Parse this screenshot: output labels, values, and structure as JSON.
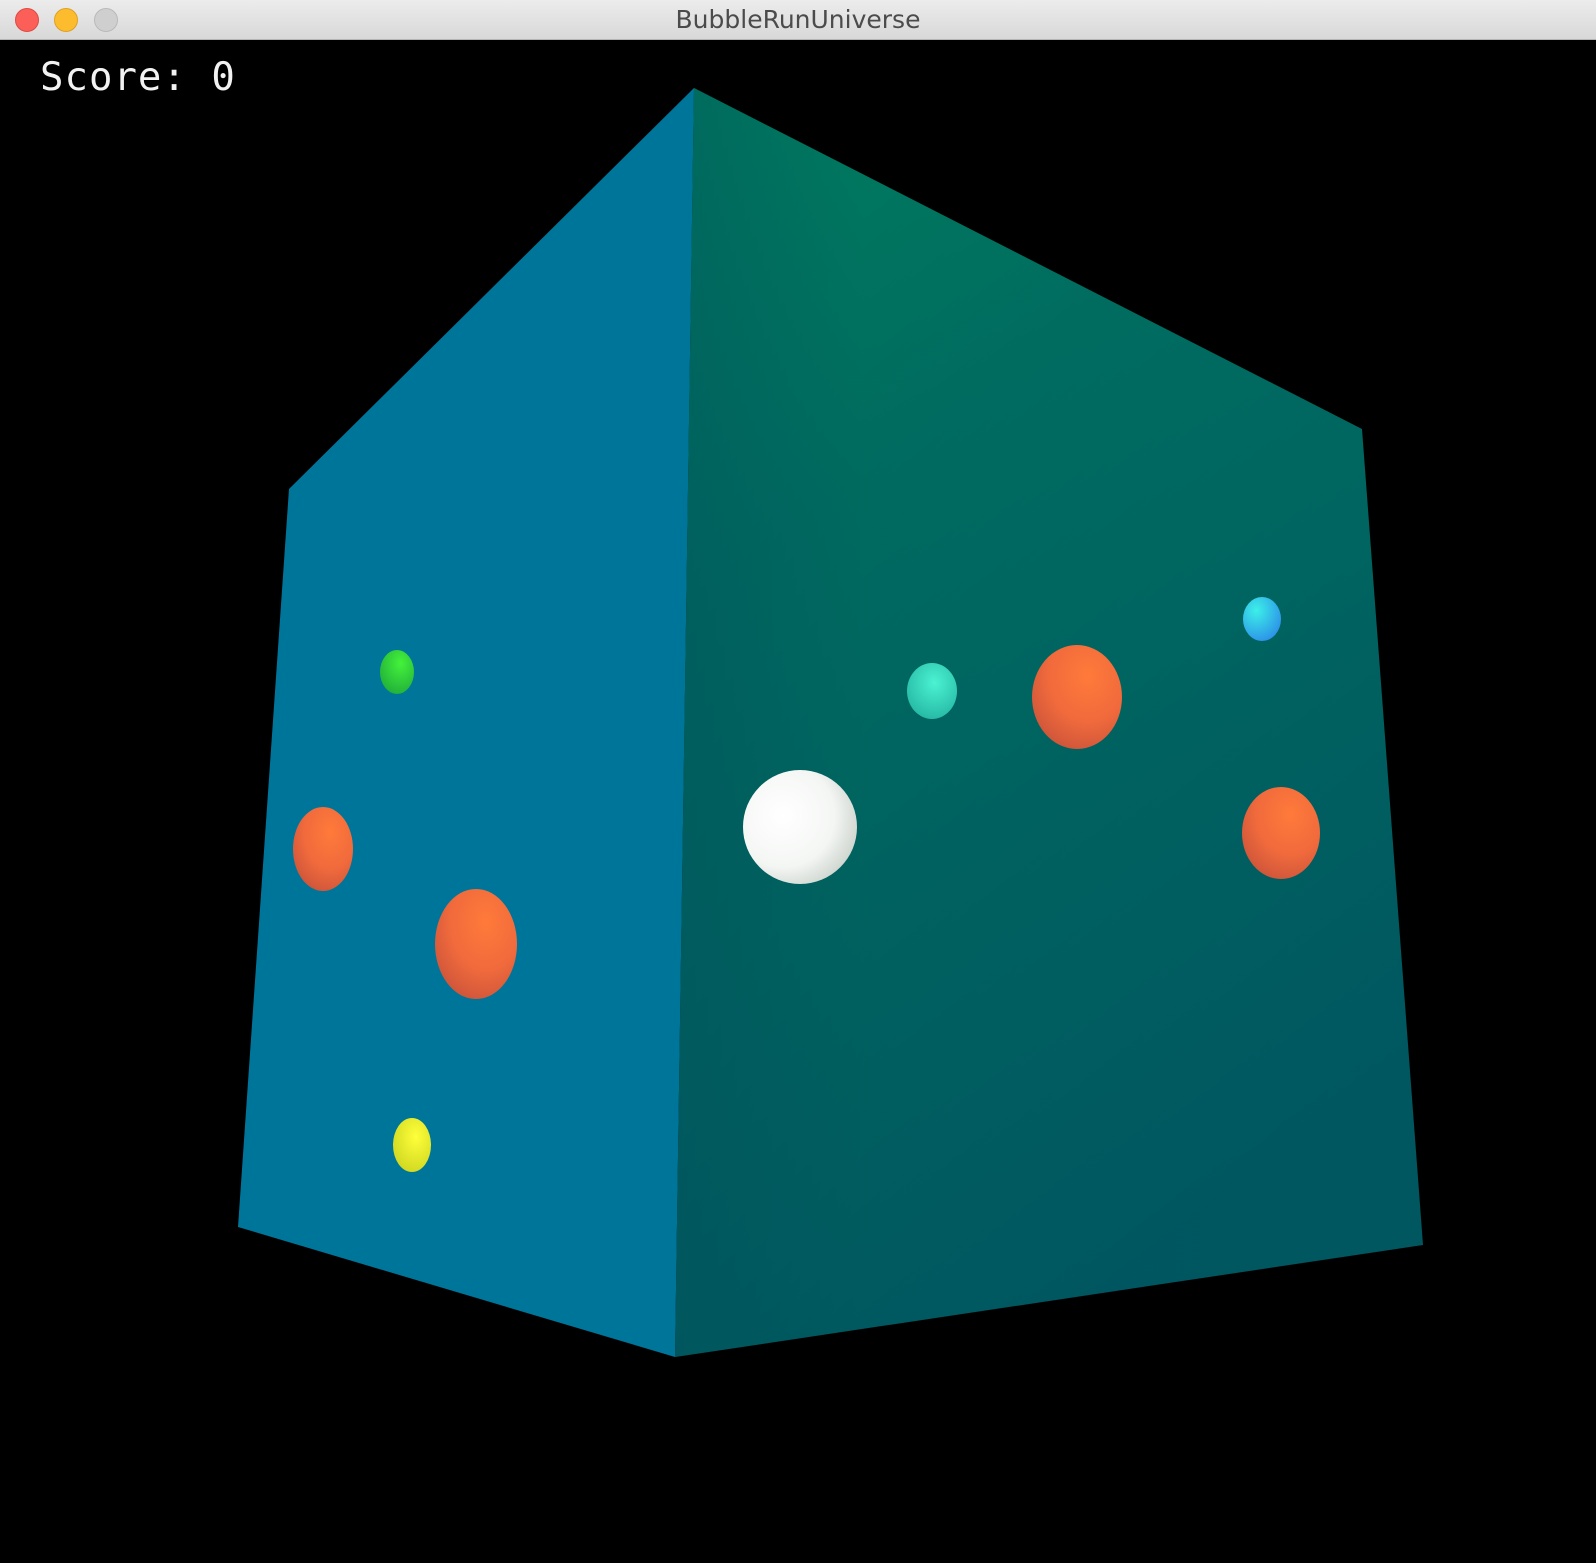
{
  "window": {
    "title": "BubbleRunUniverse"
  },
  "hud": {
    "score_text": "Score: 0"
  },
  "colors": {
    "left_face": "#00759a",
    "right_face_top": "#00875f",
    "right_face_bottom": "#005760",
    "bubble_orange": "#ff6a30",
    "bubble_green": "#33e43a",
    "bubble_cyan": "#2ee8c2",
    "bubble_blue": "#2fb6f2",
    "bubble_yellow": "#f0f022",
    "player": "#ffffff"
  }
}
